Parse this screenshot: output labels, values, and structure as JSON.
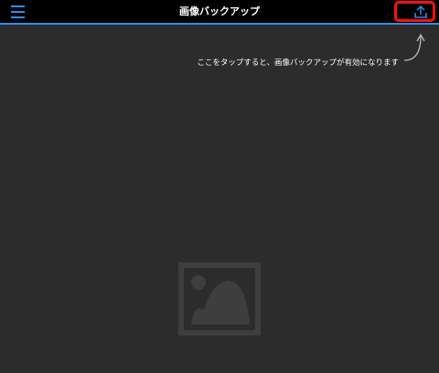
{
  "navbar": {
    "title": "画像バックアップ",
    "menu_icon": "hamburger-menu-icon",
    "upload_icon": "upload-icon",
    "accent_color": "#2d8ff0",
    "highlight_color": "#ff1010"
  },
  "hint": {
    "text": "ここをタップすると、画像バックアップが有効になります",
    "arrow_icon": "curved-arrow-up-icon"
  },
  "content": {
    "placeholder_icon": "image-placeholder-icon"
  }
}
